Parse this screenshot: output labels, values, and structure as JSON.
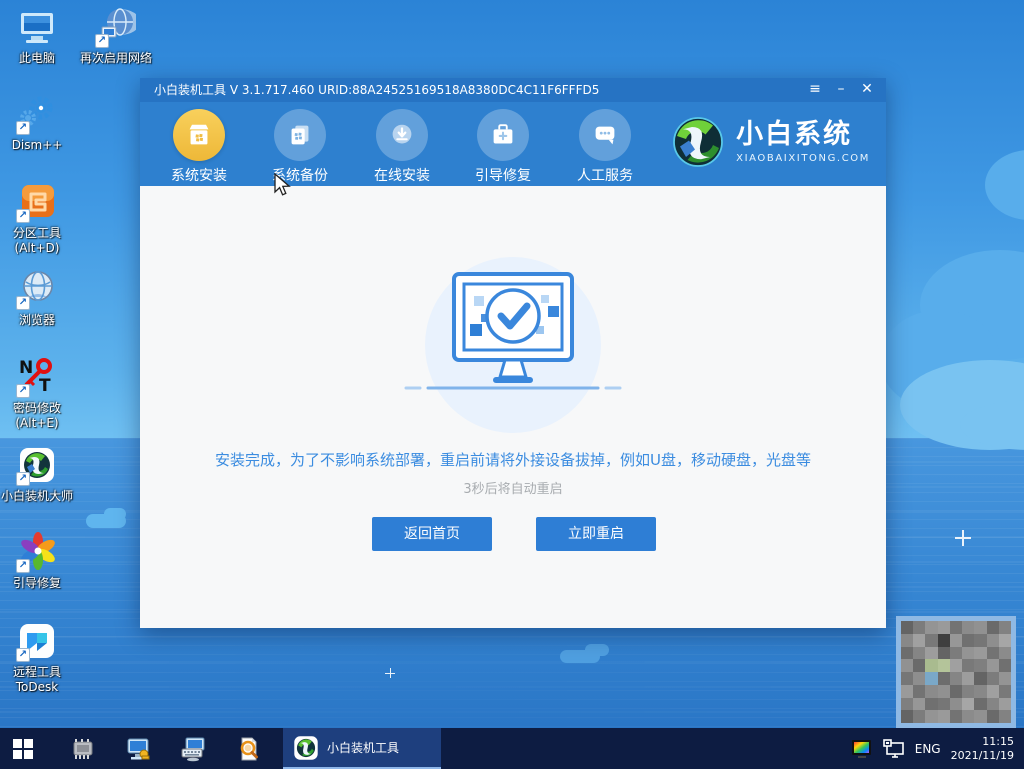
{
  "desktop": {
    "icons": [
      {
        "label": "此电脑",
        "icon": "this-pc"
      },
      {
        "label": "再次启用网络",
        "icon": "network-globe"
      },
      {
        "label": "Dism++",
        "icon": "gears"
      },
      {
        "label": "分区工具\n(Alt+D)",
        "icon": "partition-tool"
      },
      {
        "label": "浏览器",
        "icon": "browser-globe"
      },
      {
        "label": "密码修改\n(Alt+E)",
        "icon": "password-key"
      },
      {
        "label": "小白装机大师",
        "icon": "xiaobai-logo"
      },
      {
        "label": "引导修复",
        "icon": "pinwheel"
      },
      {
        "label": "远程工具\nToDesk",
        "icon": "todesk"
      }
    ]
  },
  "window": {
    "title": "小白装机工具 V 3.1.717.460 URID:88A24525169518A8380DC4C11F6FFFD5",
    "controls": {
      "menu": "≡",
      "minimize": "–",
      "close": "✕"
    },
    "nav": [
      {
        "label": "系统安装",
        "icon": "install-box",
        "active": true
      },
      {
        "label": "系统备份",
        "icon": "backup-copy",
        "active": false
      },
      {
        "label": "在线安装",
        "icon": "download-circle",
        "active": false
      },
      {
        "label": "引导修复",
        "icon": "toolbox",
        "active": false
      },
      {
        "label": "人工服务",
        "icon": "chat-bubble",
        "active": false
      }
    ],
    "brand": {
      "name": "小白系统",
      "site": "XIAOBAIXITONG.COM"
    },
    "main": {
      "message": "安装完成，为了不影响系统部署，重启前请将外接设备拔掉，例如U盘，移动硬盘，光盘等",
      "countdown": "3秒后将自动重启",
      "home_button": "返回首页",
      "restart_button": "立即重启"
    }
  },
  "taskbar": {
    "active_app": "小白装机工具",
    "tray": {
      "language": "ENG",
      "time": "11:15",
      "date": "2021/11/19"
    }
  },
  "colors": {
    "titlebar": "#2673c3",
    "toolbar": "#2e80cf",
    "active_nav": "#f2c447",
    "content_bg": "#f7f8f9",
    "message_blue": "#3b8ce0",
    "muted_gray": "#a8acb0",
    "button_blue": "#2e7ed5",
    "taskbar_navy": "#0d1c42",
    "active_tab": "#1e3f7e",
    "sky_blue": "#3f98e3",
    "sea_blue": "#2a76c6"
  }
}
